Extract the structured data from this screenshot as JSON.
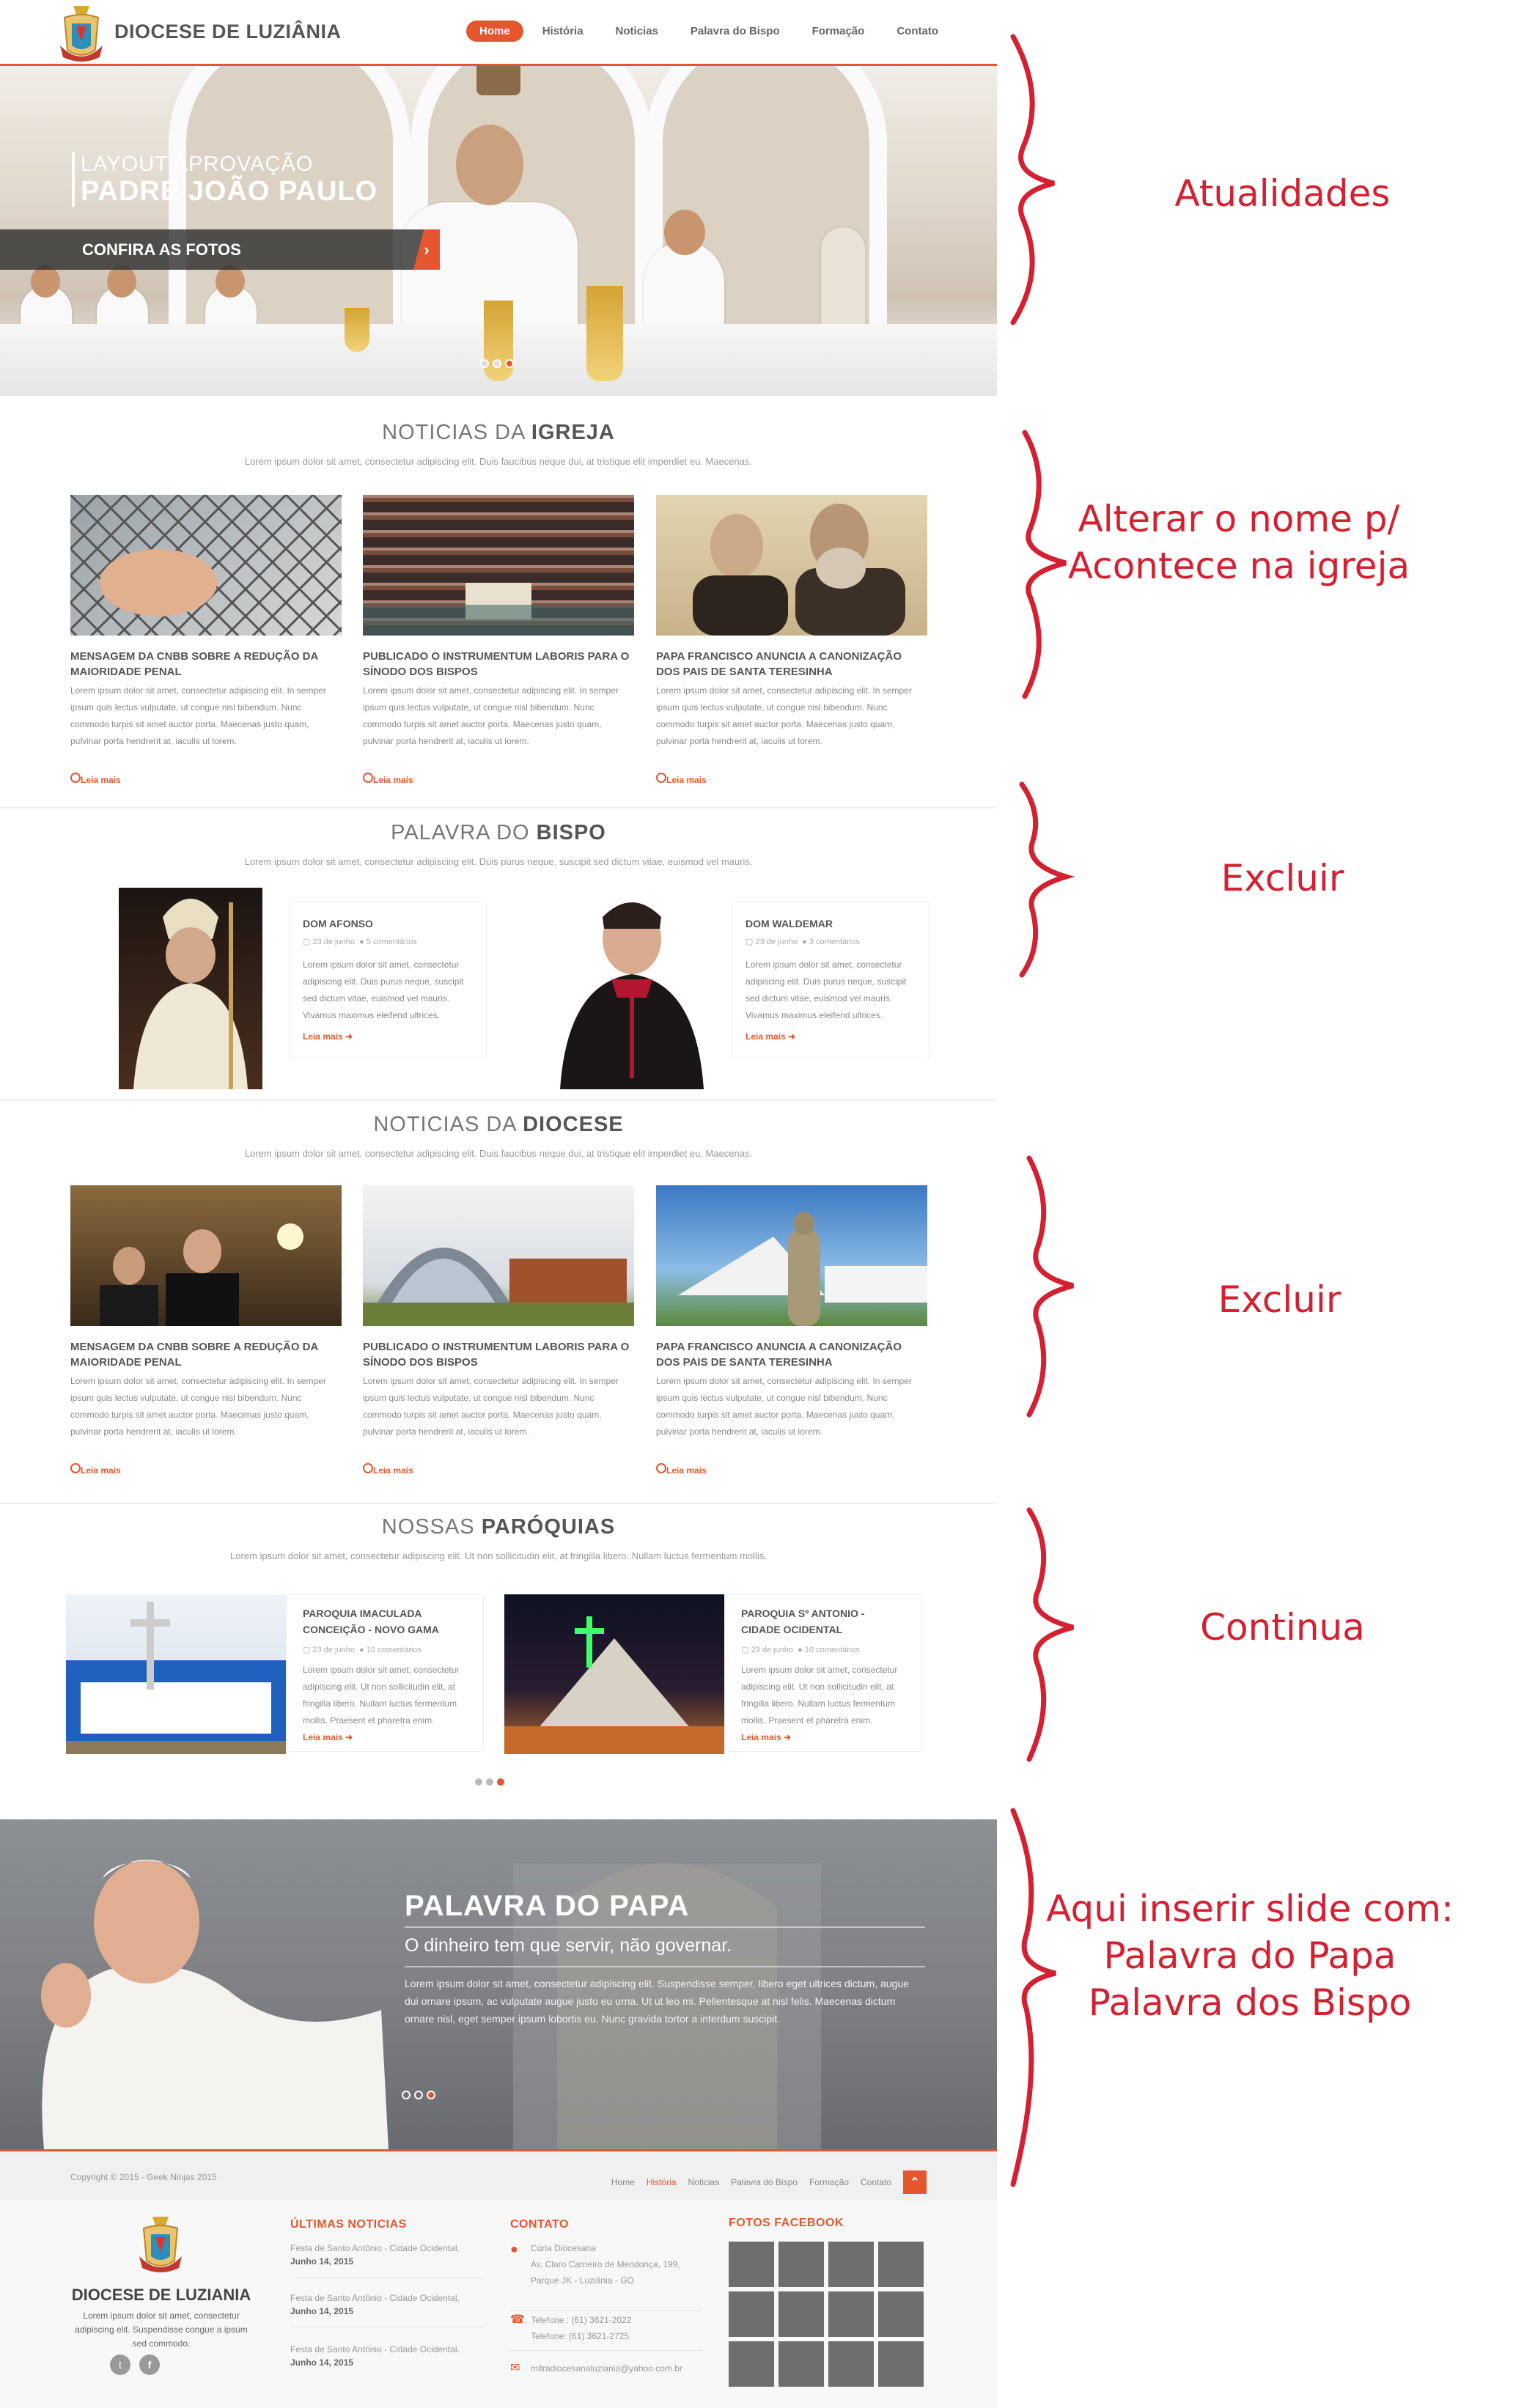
{
  "header": {
    "brand": "DIOCESE DE LUZIÂNIA",
    "nav": [
      "Home",
      "História",
      "Noticias",
      "Palavra do Bispo",
      "Formação",
      "Contato"
    ]
  },
  "hero": {
    "line1": "LAYOUT APROVAÇÃO",
    "line2": "PADRE JOÃO PAULO",
    "button": "CONFIRA AS FOTOS"
  },
  "igreja": {
    "title_light": "NOTICIAS DA",
    "title_bold": "IGREJA",
    "subtitle": "Lorem ipsum dolor sit amet, consectetur adipiscing elit. Duis faucibus neque dui, at tristique elit imperdiet eu. Maecenas.",
    "cards": [
      {
        "title": "MENSAGEM DA CNBB SOBRE A REDUÇÃO DA MAIORIDADE PENAL",
        "text": "Lorem ipsum dolor sit amet, consectetur adipiscing elit. In semper ipsum quis lectus vulputate, ut congue nisl bibendum. Nunc commodo turpis sit amet auctor porta. Maecenas justo quam, pulvinar porta hendrerit at, iaculis ut lorem.",
        "more": "Leia mais"
      },
      {
        "title": "PUBLICADO O INSTRUMENTUM LABORIS PARA O SÍNODO DOS BISPOS",
        "text": "Lorem ipsum dolor sit amet, consectetur adipiscing elit. In semper ipsum quis lectus vulputate, ut congue nisl bibendum. Nunc commodo turpis sit amet auctor porta. Maecenas justo quam, pulvinar porta hendrerit at, iaculis ut lorem.",
        "more": "Leia mais"
      },
      {
        "title": "PAPA FRANCISCO ANUNCIA A CANONIZAÇÃO DOS PAIS DE SANTA TERESINHA",
        "text": "Lorem ipsum dolor sit amet, consectetur adipiscing elit. In semper ipsum quis lectus vulputate, ut congue nisl bibendum. Nunc commodo turpis sit amet auctor porta. Maecenas justo quam, pulvinar porta hendrerit at, iaculis ut lorem.",
        "more": "Leia mais"
      }
    ]
  },
  "bispo": {
    "title_light": "PALAVRA DO",
    "title_bold": "BISPO",
    "subtitle": "Lorem ipsum dolor sit amet, consectetur adipiscing elit. Duis purus neque, suscipit sed dictum vitae, euismod vel mauris.",
    "cards": [
      {
        "name": "DOM AFONSO",
        "date": "23 de junho",
        "comments": "5 comentários",
        "text": "Lorem ipsum dolor sit amet, consectetur adipiscing elit. Duis purus neque, suscipit sed dictum vitae, euismod vel mauris. Vivamus maximus eleifend ultrices.",
        "more": "Leia mais"
      },
      {
        "name": "DOM WALDEMAR",
        "date": "23 de junho",
        "comments": "3 comentários",
        "text": "Lorem ipsum dolor sit amet, consectetur adipiscing elit. Duis purus neque, suscipit sed dictum vitae, euismod vel mauris. Vivamus maximus eleifend ultrices.",
        "more": "Leia mais"
      }
    ]
  },
  "diocese": {
    "title_light": "NOTICIAS DA",
    "title_bold": "DIOCESE",
    "subtitle": "Lorem ipsum dolor sit amet, consectetur adipiscing elit. Duis faucibus neque dui, at tristique elit imperdiet eu. Maecenas.",
    "cards": [
      {
        "title": "MENSAGEM DA CNBB SOBRE A REDUÇÃO DA MAIORIDADE PENAL",
        "text": "Lorem ipsum dolor sit amet, consectetur adipiscing elit. In semper ipsum quis lectus vulputate, ut congue nisl bibendum. Nunc commodo turpis sit amet auctor porta. Maecenas justo quam, pulvinar porta hendrerit at, iaculis ut lorem.",
        "more": "Leia mais"
      },
      {
        "title": "PUBLICADO O INSTRUMENTUM LABORIS PARA O SÍNODO DOS BISPOS",
        "text": "Lorem ipsum dolor sit amet, consectetur adipiscing elit. In semper ipsum quis lectus vulputate, ut congue nisl bibendum. Nunc commodo turpis sit amet auctor porta. Maecenas justo quam, pulvinar porta hendrerit at, iaculis ut lorem.",
        "more": "Leia mais"
      },
      {
        "title": "PAPA FRANCISCO ANUNCIA A CANONIZAÇÃO DOS PAIS DE SANTA TERESINHA",
        "text": "Lorem ipsum dolor sit amet, consectetur adipiscing elit. In semper ipsum quis lectus vulputate, ut congue nisl bibendum. Nunc commodo turpis sit amet auctor porta. Maecenas justo quam, pulvinar porta hendrerit at, iaculis ut lorem.",
        "more": "Leia mais"
      }
    ]
  },
  "paroquias": {
    "title_light": "NOSSAS",
    "title_bold": "PARÓQUIAS",
    "subtitle": "Lorem ipsum dolor sit amet, consectetur adipiscing elit. Ut non sollicitudin elit, at fringilla libero. Nullam luctus fermentum mollis.",
    "cards": [
      {
        "name": "PAROQUIA IMACULADA CONCEIÇÃO - NOVO GAMA",
        "date": "23 de junho",
        "comments": "10 comentários",
        "text": "Lorem ipsum dolor sit amet, consectetur adipiscing elit. Ut non sollicitudin elit, at fringilla libero. Nullam luctus fermentum mollis. Praesent et pharetra enim.",
        "more": "Leia mais"
      },
      {
        "name": "PAROQUIA Sº ANTONIO - CIDADE OCIDENTAL",
        "date": "23 de junho",
        "comments": "10 comentários",
        "text": "Lorem ipsum dolor sit amet, consectetur adipiscing elit. Ut non sollicitudin elit, at fringilla libero. Nullam luctus fermentum mollis. Praesent et pharetra enim.",
        "more": "Leia mais"
      }
    ]
  },
  "papa": {
    "title": "PALAVRA DO PAPA",
    "subtitle": "O dinheiro tem que servir, não governar.",
    "text": "Lorem ipsum dolor sit amet, consectetur adipiscing elit. Suspendisse semper, libero eget ultrices dictum, augue dui ornare ipsum, ac vulputate augue justo eu urna. Ut ut leo mi. Pellentesque at nisl felis. Maecenas dictum ornare nisl, eget semper ipsum lobortis eu. Nunc gravida tortor a interdum suscipit."
  },
  "footer_bar": {
    "copyright": "Copyright © 2015 - Geek Ninjas 2015",
    "links": [
      "Home",
      "História",
      "Noticias",
      "Palavra do Bispo",
      "Formação",
      "Contato"
    ],
    "top_icon": "chevron-up-icon"
  },
  "footer": {
    "brand": "DIOCESE DE LUZIANIA",
    "about": "Lorem ipsum dolor sit amet, consectetur adipiscing elit. Suspendisse congue a ipsum sed commodo.",
    "news_heading": "ÚLTIMAS NOTICIAS",
    "news": [
      {
        "title": "Festa de Santo Antônio - Cidade Ocidental.",
        "date": "Junho 14, 2015"
      },
      {
        "title": "Festa de Santo Antônio - Cidade Ocidental.",
        "date": "Junho 14, 2015"
      },
      {
        "title": "Festa de Santo Antônio - Cidade Ocidental.",
        "date": "Junho 14, 2015"
      }
    ],
    "contact_heading": "CONTATO",
    "address": [
      "Cúria Diocesana",
      "Av. Claro Carneiro de Mendonça, 199,",
      "Parque JK - Luziânia - GO"
    ],
    "phones": [
      "Telefone : (61) 3621-2022",
      "Telefone: (61) 3621-2725"
    ],
    "email": "mitradiocesanaluziania@yahoo.com.br",
    "photos_heading": "FOTOS FACEBOOK"
  },
  "annotations": [
    {
      "text": "Atualidades"
    },
    {
      "text": "Alterar o nome p/ Acontece na igreja"
    },
    {
      "text": "Excluir"
    },
    {
      "text": "Excluir"
    },
    {
      "text": "Continua"
    },
    {
      "text": "Aqui inserir slide com: Palavra do Papa Palavra dos Bispo"
    }
  ],
  "colors": {
    "accent": "#e4572e",
    "annotation": "#d42030"
  }
}
